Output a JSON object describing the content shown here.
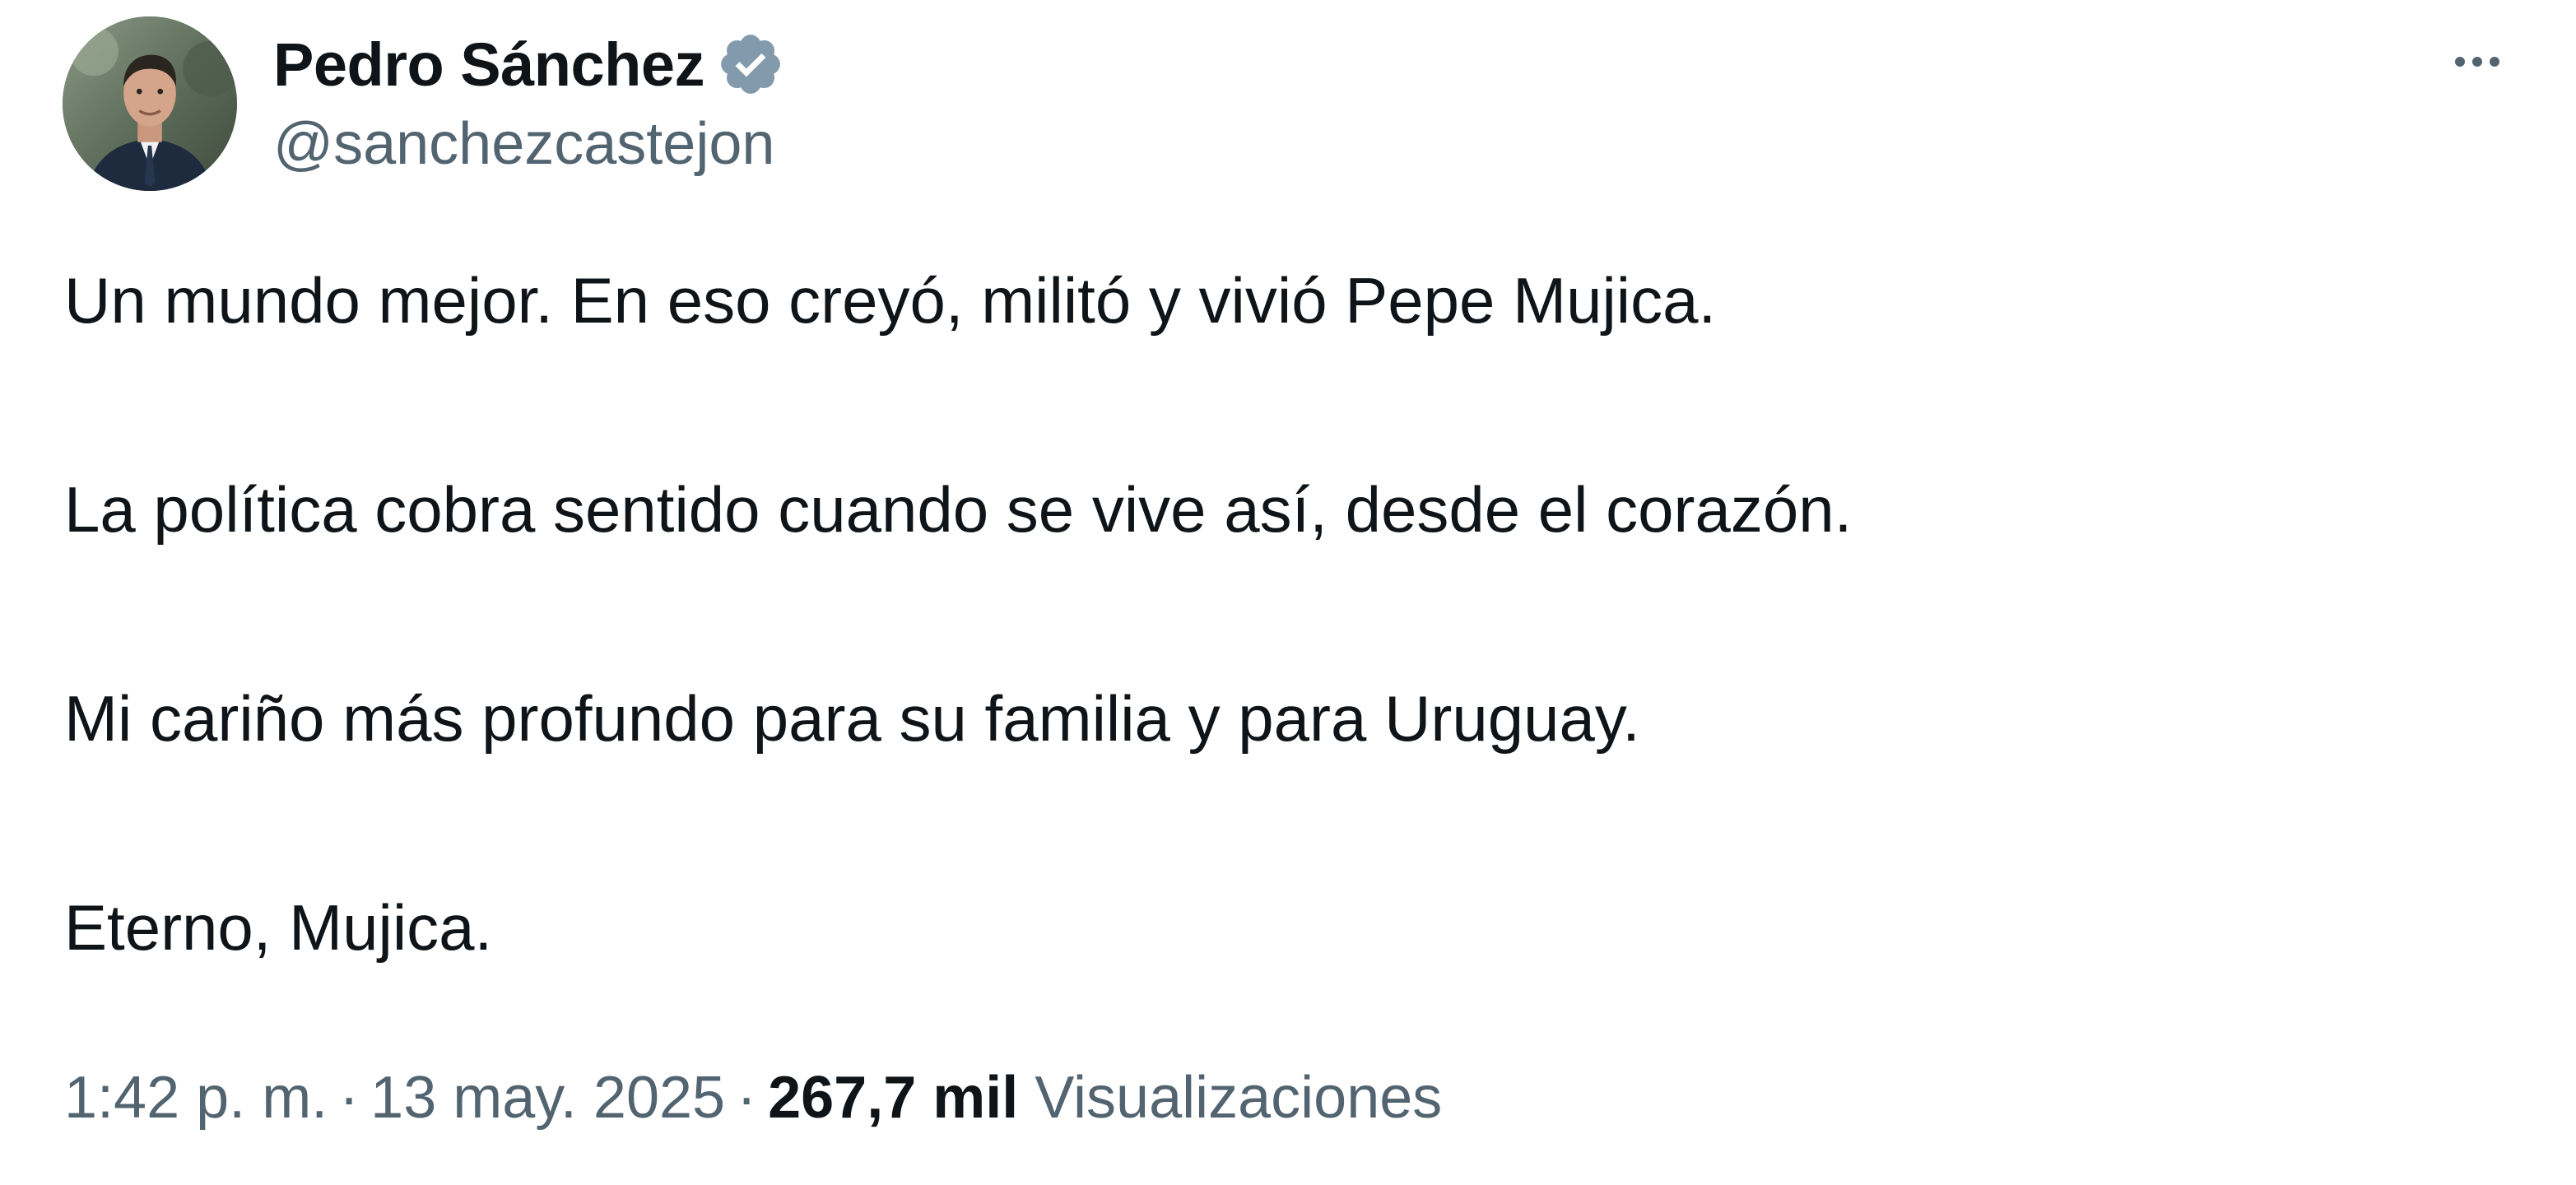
{
  "author": {
    "display_name": "Pedro Sánchez",
    "handle": "@sanchezcastejon",
    "verified": true,
    "verified_badge_color": "#829aab",
    "avatar_icon": "profile-photo"
  },
  "more_icon": "more-dots-icon",
  "tweet": {
    "paragraphs": [
      "Un mundo mejor. En eso creyó, militó y vivió Pepe Mujica.",
      "La política cobra sentido cuando se vive así, desde el corazón.",
      "Mi cariño más profundo para su familia y para Uruguay.",
      "Eterno, Mujica."
    ]
  },
  "meta": {
    "time": "1:42 p. m.",
    "separator": "·",
    "date": "13 may. 2025",
    "views_count": "267,7 mil",
    "views_label": "Visualizaciones"
  },
  "colors": {
    "text_primary": "#0f1419",
    "text_secondary": "#536471",
    "background": "#ffffff"
  }
}
